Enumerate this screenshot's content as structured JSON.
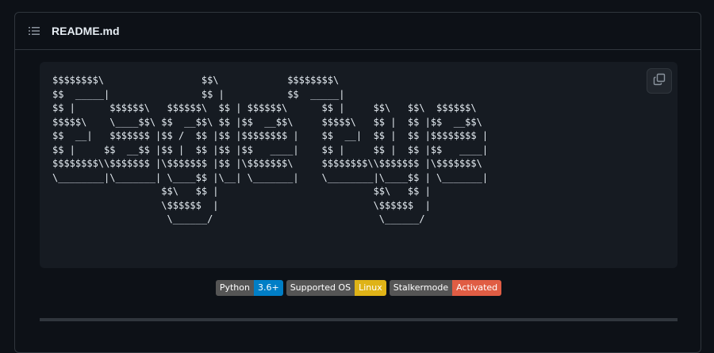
{
  "readme": {
    "filename": "README.md",
    "icons": {
      "list": "list-unordered-icon",
      "copy": "copy-icon"
    }
  },
  "ascii_art": "$$$$$$$$\\                 $$\\            $$$$$$$$\\\n$$  _____|                $$ |           $$  _____|\n$$ |      $$$$$$\\   $$$$$$\\  $$ | $$$$$$\\      $$ |     $$\\   $$\\  $$$$$$\\\n$$$$$\\    \\____$$\\ $$  __$$\\ $$ |$$  __$$\\     $$$$$\\   $$ |  $$ |$$  __$$\\\n$$  __|   $$$$$$$ |$$ /  $$ |$$ |$$$$$$$$ |    $$  __|  $$ |  $$ |$$$$$$$$ |\n$$ |     $$  __$$ |$$ |  $$ |$$ |$$   ____|    $$ |     $$ |  $$ |$$   ____|\n$$$$$$$$\\\\$$$$$$$ |\\$$$$$$$ |$$ |\\$$$$$$$\\     $$$$$$$$\\\\$$$$$$$ |\\$$$$$$$\\\n\\________|\\_______| \\____$$ |\\__| \\_______|    \\________|\\____$$ | \\_______|\n                   $$\\   $$ |                           $$\\   $$ |\n                   \\$$$$$$  |                           \\$$$$$$  |\n                    \\______/                             \\______/",
  "badges": [
    {
      "label": "Python",
      "value": "3.6+",
      "color": "#007ec6"
    },
    {
      "label": "Supported OS",
      "value": "Linux",
      "color": "#dfb317"
    },
    {
      "label": "Stalkermode",
      "value": "Activated",
      "color": "#e05d44"
    }
  ],
  "colors": {
    "background": "#0d1117",
    "code_background": "#161b22",
    "border": "#30363d",
    "text": "#e6edf3"
  }
}
